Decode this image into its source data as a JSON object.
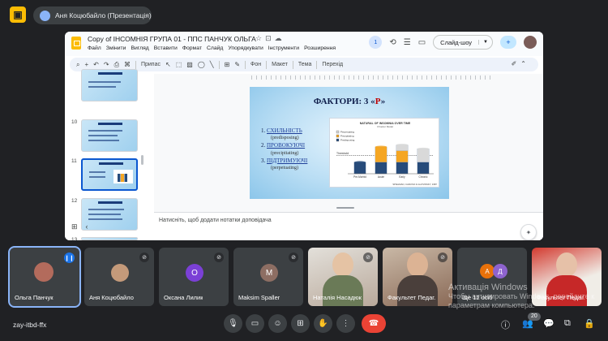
{
  "presenter_chip": "Аня Коцюбайло (Презентація)",
  "slides_app": {
    "title": "Copy of ІНСОМНІЯ  ГРУПА 01 - ППС ПАНЧУК ОЛЬГА",
    "menu": [
      "Файл",
      "Змінити",
      "Вигляд",
      "Вставити",
      "Формат",
      "Слайд",
      "Упорядкувати",
      "Інструменти",
      "Розширення"
    ],
    "badge": "1",
    "slideshow_button": "Слайд-шоу",
    "toolbar_zoom": "Припас",
    "toolbar_items": [
      "Фон",
      "Макет",
      "Тема",
      "Перехід"
    ],
    "thumb_numbers": [
      "10",
      "11",
      "12",
      "13"
    ],
    "notes_placeholder": "Натисніть, щоб додати нотатки доповідача",
    "slide": {
      "title_main": "ФАКТОРИ: 3 «",
      "title_red": "Р",
      "title_end": "»",
      "items": [
        {
          "num": "1.",
          "label": "СХИЛЬНІСТЬ",
          "sub": "(predisposing)"
        },
        {
          "num": "2.",
          "label": "ПРОВОКУЮЧІ",
          "sub": "(precipitating)"
        },
        {
          "num": "3.",
          "label": "ПІДТРИМУЮЧІ",
          "sub": "(perpetuating)"
        }
      ]
    }
  },
  "chart_data": {
    "type": "bar",
    "title": "NATURAL OF INSOMNIA OVER TIME",
    "subtitle": "3 Factor Model",
    "legend": [
      "Perpetuating",
      "Precipitating",
      "Predisposing"
    ],
    "threshold_label": "Threshold",
    "categories": [
      "Pre-Morbid",
      "Acute",
      "Early",
      "Chronic"
    ],
    "footer": "SPIELMAN, CARUSO & GLOVINSKY, 1987",
    "series": [
      {
        "name": "Predisposing",
        "values": [
          3,
          3,
          3,
          3
        ],
        "color": "#274b7a"
      },
      {
        "name": "Precipitating",
        "values": [
          0,
          4,
          3,
          0
        ],
        "color": "#f5a623"
      },
      {
        "name": "Perpetuating",
        "values": [
          0,
          0,
          1.5,
          3.5
        ],
        "color": "#d9d9d9"
      }
    ],
    "ylim": [
      0,
      11
    ],
    "threshold": 4.8
  },
  "participants": [
    {
      "name": "Ольга Панчук",
      "type": "avatar",
      "speaking": true
    },
    {
      "name": "Аня Коцюбайло",
      "type": "avatar",
      "muted": true
    },
    {
      "name": "Оксана Лилик",
      "type": "initial",
      "initial": "О",
      "color": "#7b40d6",
      "muted": true
    },
    {
      "name": "Maksim Spaller",
      "type": "initial",
      "initial": "M",
      "color": "#8d6e63",
      "muted": true
    },
    {
      "name": "Наталія Насадюк",
      "type": "video",
      "muted": true
    },
    {
      "name": "Факультет Педаг.",
      "type": "video",
      "muted": true
    },
    {
      "name": "Ще 12 осіб",
      "type": "group"
    },
    {
      "name": "Факультет Педаг.",
      "type": "video"
    }
  ],
  "group_initials": [
    "А",
    "Д"
  ],
  "windows_watermark": {
    "line1": "Активація Windows",
    "line2": "Чтобы активировать Windows, перейдите к",
    "line3": "параметрам компьютера."
  },
  "participants_count": "20",
  "meeting_code": "zay-itbd-ffx"
}
